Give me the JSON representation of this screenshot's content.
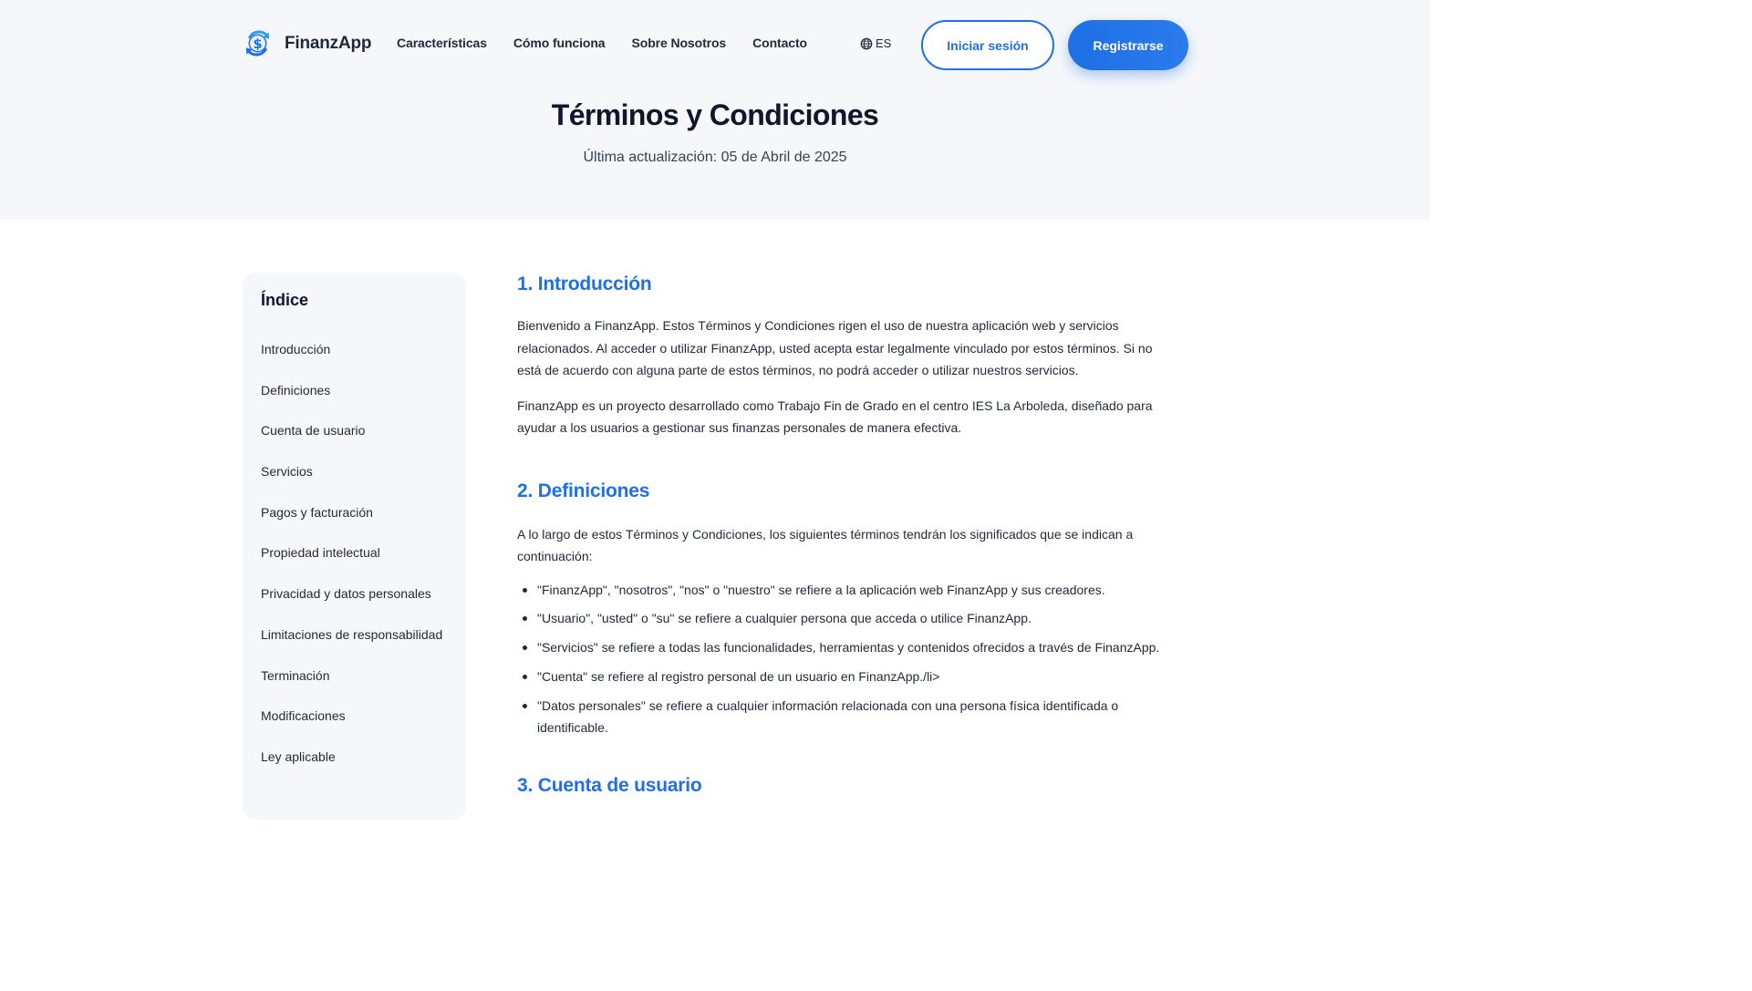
{
  "brand": {
    "name": "FinanzApp",
    "accent": "#1f6fe5",
    "logo_icon": "dollar-cycle-icon"
  },
  "nav": {
    "links": [
      "Características",
      "Cómo funciona",
      "Sobre Nosotros",
      "Contacto"
    ],
    "language": "ES",
    "login_label": "Iniciar sesión",
    "register_label": "Registrarse"
  },
  "hero": {
    "title": "Términos y Condiciones",
    "subtitle": "Última actualización: 05 de Abril de 2025"
  },
  "toc": {
    "title": "Índice",
    "items": [
      "Introducción",
      "Definiciones",
      "Cuenta de usuario",
      "Servicios",
      "Pagos y facturación",
      "Propiedad intelectual",
      "Privacidad y datos personales",
      "Limitaciones de responsabilidad",
      "Terminación",
      "Modificaciones",
      "Ley aplicable"
    ]
  },
  "sections": {
    "s1": {
      "heading": "1. Introducción",
      "paragraphs": [
        "Bienvenido a FinanzApp. Estos Términos y Condiciones rigen el uso de nuestra aplicación web y servicios relacionados. Al acceder o utilizar FinanzApp, usted acepta estar legalmente vinculado por estos términos. Si no está de acuerdo con alguna parte de estos términos, no podrá acceder o utilizar nuestros servicios.",
        "FinanzApp es un proyecto desarrollado como Trabajo Fin de Grado en el centro IES La Arboleda, diseñado para ayudar a los usuarios a gestionar sus finanzas personales de manera efectiva."
      ]
    },
    "s2": {
      "heading": "2. Definiciones",
      "intro": "A lo largo de estos Términos y Condiciones, los siguientes términos tendrán los significados que se indican a continuación:",
      "bullets": [
        "\"FinanzApp\", \"nosotros\", \"nos\" o \"nuestro\" se refiere a la aplicación web FinanzApp y sus creadores.",
        "\"Usuario\", \"usted\" o \"su\" se refiere a cualquier persona que acceda o utilice FinanzApp.",
        "\"Servicios\" se refiere a todas las funcionalidades, herramientas y contenidos ofrecidos a través de FinanzApp.",
        "\"Cuenta\" se refiere al registro personal de un usuario en FinanzApp./li>",
        "\"Datos personales\" se refiere a cualquier información relacionada con una persona física identificada o identificable."
      ]
    },
    "s3": {
      "heading": "3. Cuenta de usuario"
    }
  }
}
